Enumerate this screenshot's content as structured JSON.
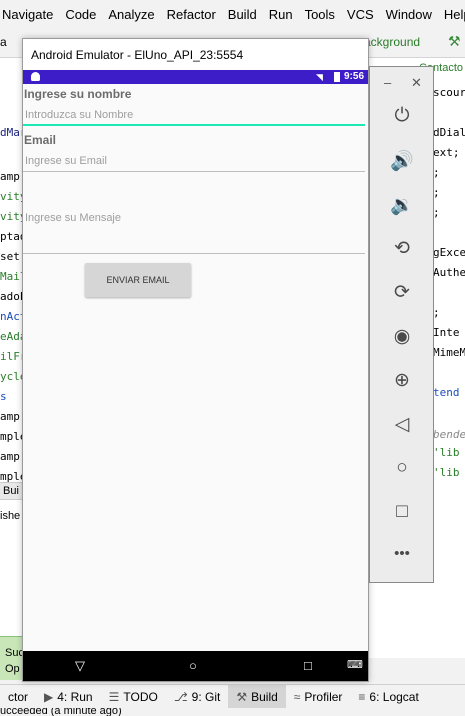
{
  "menu": [
    "Navigate",
    "Code",
    "Analyze",
    "Refactor",
    "Build",
    "Run",
    "Tools",
    "VCS",
    "Window",
    "Help"
  ],
  "nav": {
    "crumb": "a",
    "background_tab": "ackground"
  },
  "editor": {
    "left_fragments": [
      "dMar",
      "amp",
      "vityA",
      "vityM",
      "ptad",
      "set",
      "Mail",
      "adoP",
      "nAct",
      "eAda",
      "ilFra",
      "ycler",
      "s",
      "amp",
      "mple",
      "amp",
      "mple"
    ],
    "right_fragments": [
      "scour",
      "dDial",
      "ext;",
      ";",
      ";",
      ";",
      "gExce",
      "Authe",
      ";",
      "Inte",
      "MimeM",
      "tend",
      "bende",
      "'lib",
      "'lib"
    ],
    "right_top_tab": "Contacto",
    "run_tab": "Bui",
    "run_text": "ishe"
  },
  "success": {
    "line1": "Suc",
    "line2": "Op"
  },
  "emulator": {
    "title": "Android Emulator - ElUno_API_23:5554",
    "status_time": "9:56",
    "form": {
      "name_label": "Ingrese su nombre",
      "name_placeholder": "Introduzca su Nombre",
      "email_label": "Email",
      "email_placeholder": "Ingrese su Email",
      "message_placeholder": "Ingrese su Mensaje",
      "send_button": "ENVIAR EMAIL"
    },
    "side_controls": [
      "power-icon",
      "volume-up-icon",
      "volume-down-icon",
      "rotate-left-icon",
      "rotate-right-icon",
      "camera-icon",
      "zoom-icon",
      "back-icon",
      "home-icon",
      "overview-icon",
      "more-icon"
    ],
    "accent_color": "#3c1dc7",
    "focus_color": "#1de9b6"
  },
  "toolbar": {
    "items": [
      {
        "label": "ctor"
      },
      {
        "label": "4: Run",
        "icon": "run-icon"
      },
      {
        "label": "TODO",
        "icon": "todo-icon"
      },
      {
        "label": "9: Git",
        "icon": "git-icon"
      },
      {
        "label": "Build",
        "icon": "build-icon",
        "active": true
      },
      {
        "label": "Profiler",
        "icon": "profiler-icon"
      },
      {
        "label": "6: Logcat",
        "icon": "logcat-icon"
      }
    ]
  },
  "status": "ucceeded (a minute ago)"
}
